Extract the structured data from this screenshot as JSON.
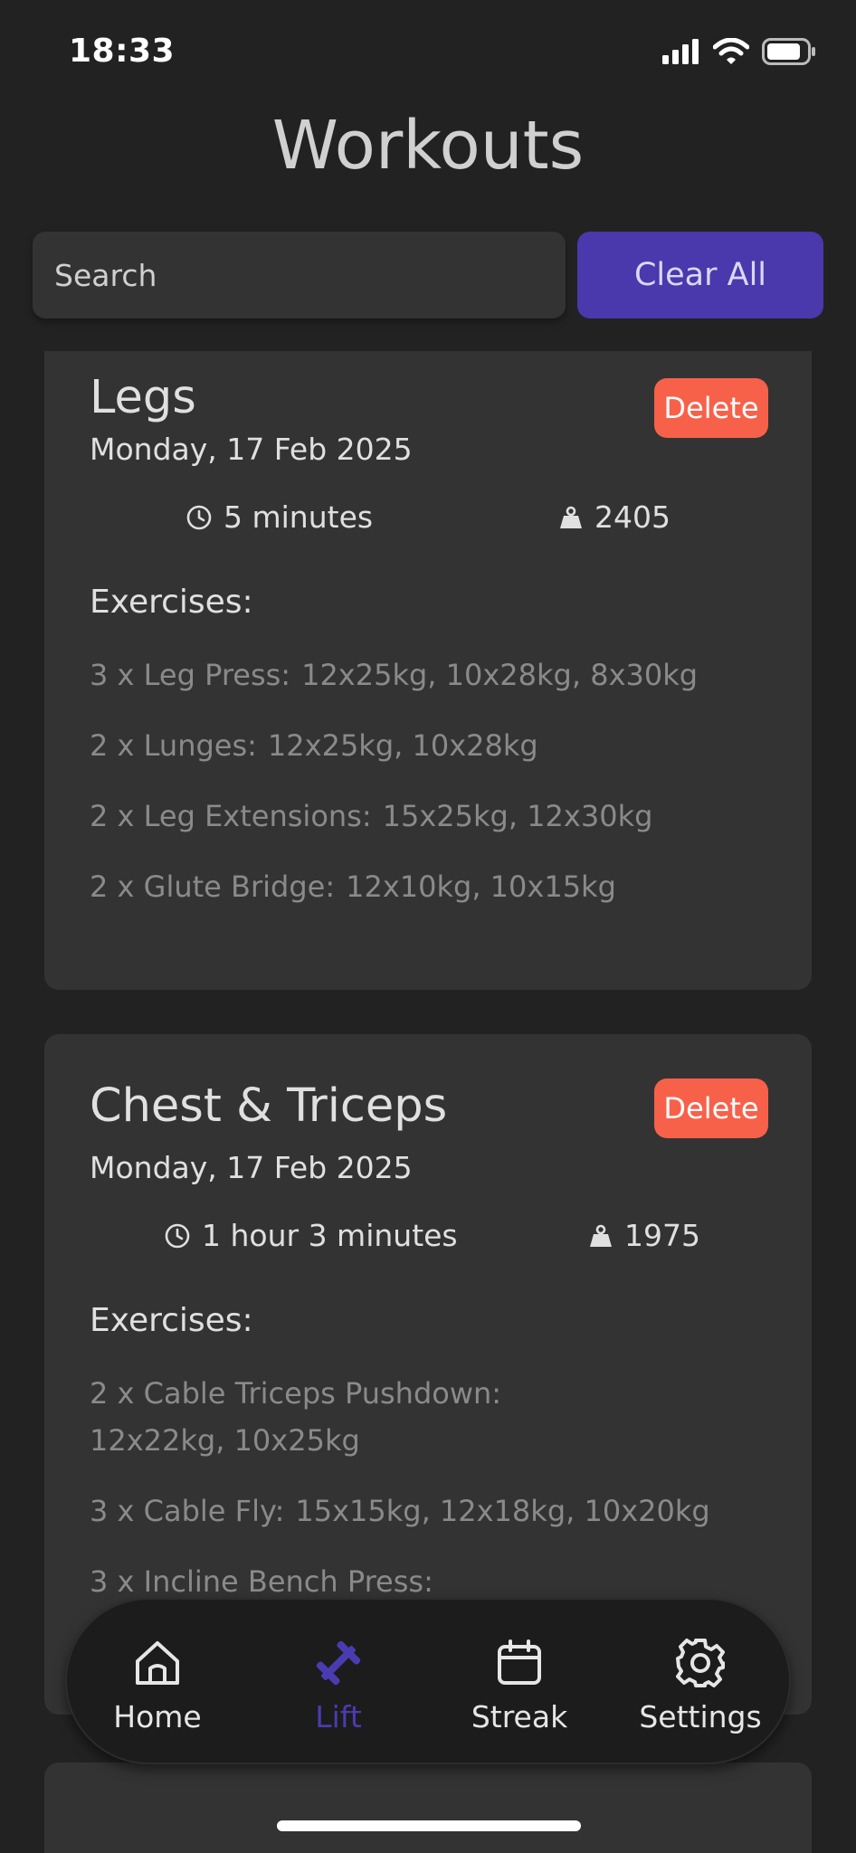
{
  "status_bar": {
    "time": "18:33"
  },
  "header": {
    "title": "Workouts"
  },
  "search": {
    "placeholder": "Search",
    "value": ""
  },
  "actions": {
    "clear_all_label": "Clear All"
  },
  "workouts": [
    {
      "title": "Legs",
      "date": "Monday, 17 Feb 2025",
      "duration": "5 minutes",
      "volume": "2405",
      "delete_label": "Delete",
      "exercises_heading": "Exercises:",
      "exercises": [
        {
          "name": "3 x Leg Press:",
          "sets": "12x25kg, 10x28kg, 8x30kg"
        },
        {
          "name": "2 x Lunges:",
          "sets": "12x25kg, 10x28kg"
        },
        {
          "name": "2 x Leg Extensions:",
          "sets": "15x25kg, 12x30kg"
        },
        {
          "name": "2 x Glute Bridge:",
          "sets": "12x10kg, 10x15kg"
        }
      ]
    },
    {
      "title": "Chest & Triceps",
      "date": "Monday, 17 Feb 2025",
      "duration": "1 hour 3 minutes",
      "volume": "1975",
      "delete_label": "Delete",
      "exercises_heading": "Exercises:",
      "exercises": [
        {
          "name": "2 x Cable Triceps Pushdown:",
          "sets": "12x22kg, 10x25kg"
        },
        {
          "name": "3 x Cable Fly:",
          "sets": "15x15kg, 12x18kg, 10x20kg"
        },
        {
          "name": "3 x Incline Bench Press:",
          "sets": ""
        }
      ]
    }
  ],
  "tab_bar": {
    "active": "Lift",
    "active_color": "#4a3cb0",
    "items": [
      {
        "label": "Home",
        "icon": "home-icon"
      },
      {
        "label": "Lift",
        "icon": "dumbbell-icon"
      },
      {
        "label": "Streak",
        "icon": "calendar-icon"
      },
      {
        "label": "Settings",
        "icon": "gear-icon"
      }
    ]
  },
  "colors": {
    "background": "#222222",
    "card": "#333333",
    "accent": "#4a38ad",
    "delete": "#f7614a"
  }
}
